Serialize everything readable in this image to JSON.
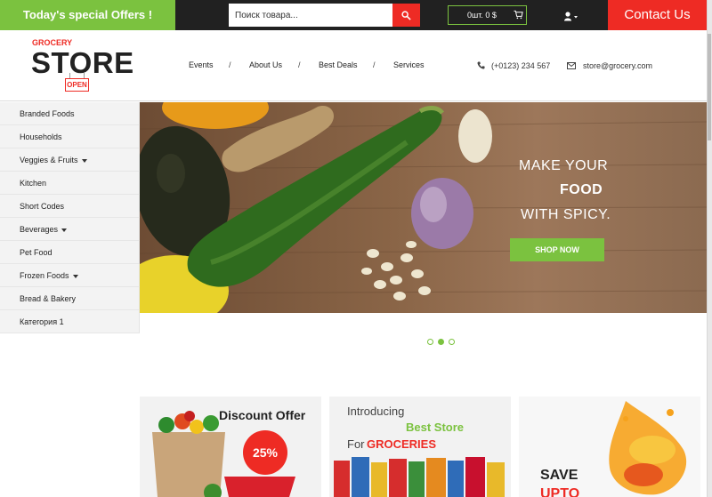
{
  "topbar": {
    "offers_text": "Today's special Offers !",
    "search_placeholder": "Поиск товара...",
    "cart_text": "0шт. 0 $",
    "contact_text": "Contact Us"
  },
  "logo": {
    "small": "GROCERY",
    "big": "STORE",
    "sign": "OPEN"
  },
  "nav": {
    "items": [
      "Events",
      "About Us",
      "Best Deals",
      "Services"
    ],
    "separator": "/"
  },
  "contact_info": {
    "phone": "(+0123) 234 567",
    "email": "store@grocery.com"
  },
  "sidebar": {
    "items": [
      {
        "label": "Branded Foods",
        "has_dropdown": false
      },
      {
        "label": "Households",
        "has_dropdown": false
      },
      {
        "label": "Veggies & Fruits",
        "has_dropdown": true
      },
      {
        "label": "Kitchen",
        "has_dropdown": false
      },
      {
        "label": "Short Codes",
        "has_dropdown": false
      },
      {
        "label": "Beverages",
        "has_dropdown": true
      },
      {
        "label": "Pet Food",
        "has_dropdown": false
      },
      {
        "label": "Frozen Foods",
        "has_dropdown": true
      },
      {
        "label": "Bread & Bakery",
        "has_dropdown": false
      },
      {
        "label": "Категория 1",
        "has_dropdown": false
      }
    ]
  },
  "banner": {
    "line1": "MAKE YOUR",
    "line2": "FOOD",
    "line3": "WITH SPICY.",
    "button": "SHOP NOW",
    "slide_count": 3,
    "active_slide": 2
  },
  "promos": {
    "discount_title": "Discount Offer",
    "discount_badge": "25%",
    "introducing": "Introducing",
    "best_store": "Best Store",
    "for_text": "For",
    "groceries": "GROCERIES",
    "save_text": "SAVE",
    "upto_text": "UPTO"
  },
  "colors": {
    "green": "#7bc23f",
    "red": "#ee2b24",
    "dark": "#212121"
  },
  "icons": [
    "search-icon",
    "cart-icon",
    "user-icon",
    "phone-icon",
    "mail-icon"
  ]
}
